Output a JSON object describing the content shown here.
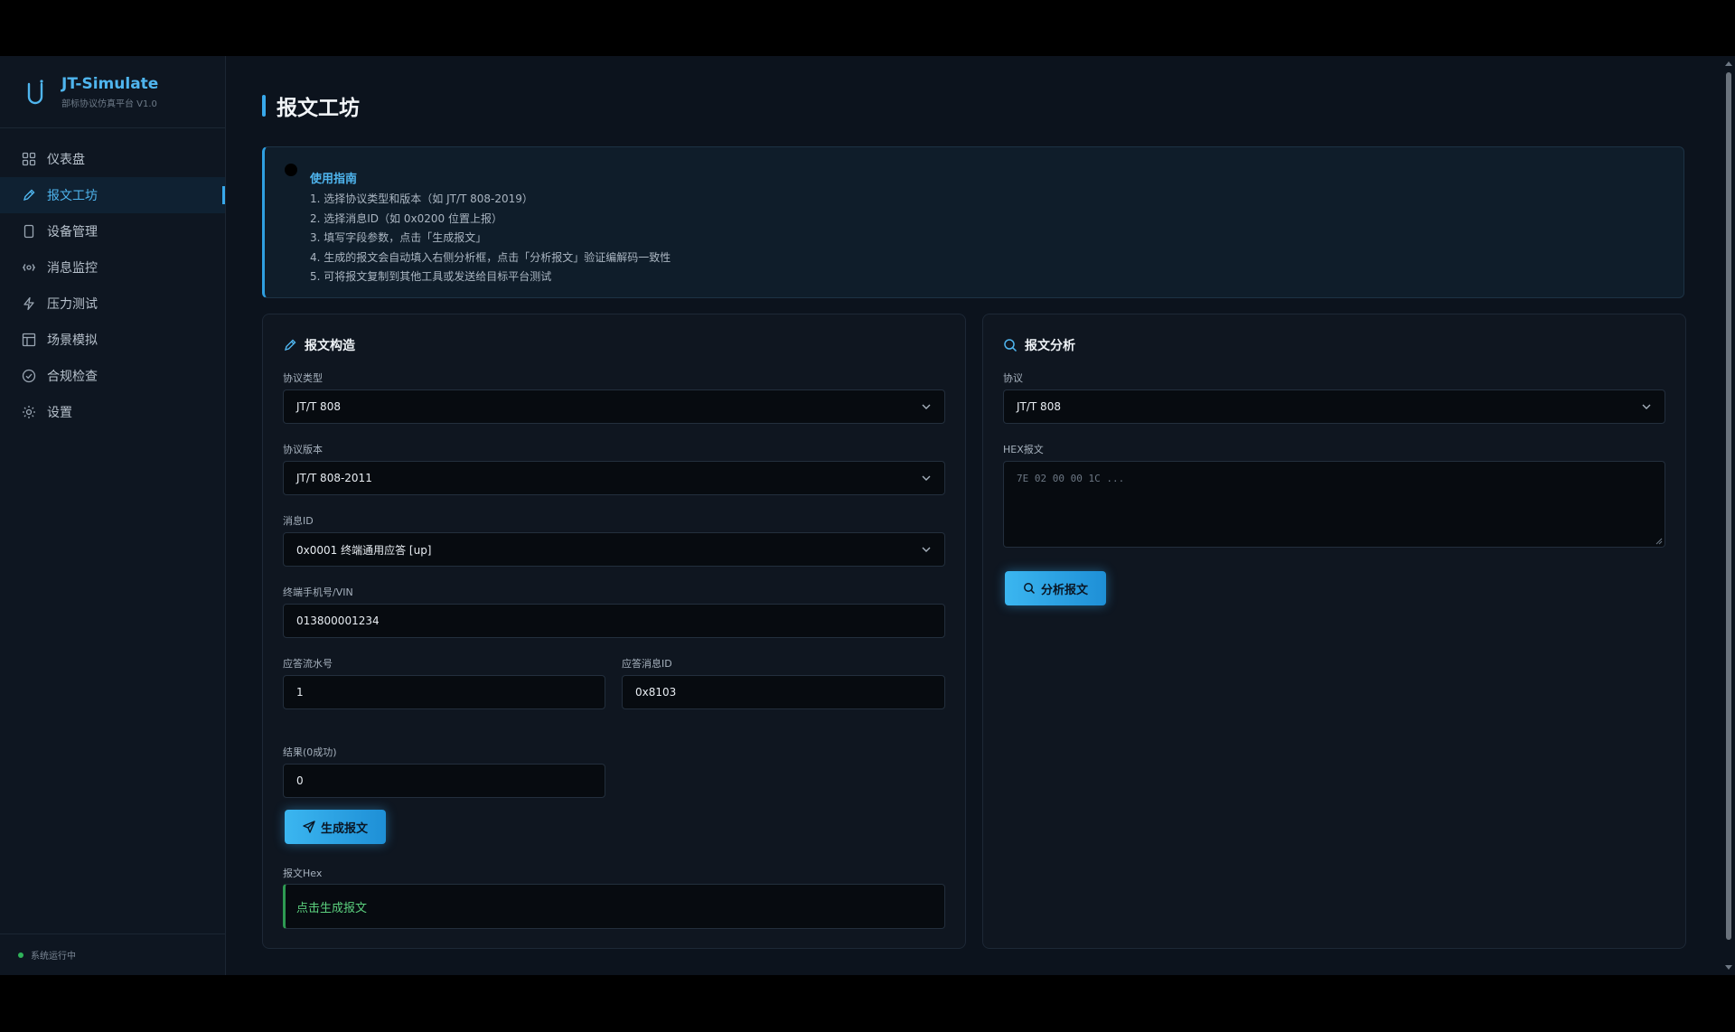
{
  "brand": {
    "title": "JT-Simulate",
    "subtitle": "部标协议仿真平台 V1.0"
  },
  "sidebar": {
    "items": [
      {
        "label": "仪表盘",
        "icon": "dashboard-icon"
      },
      {
        "label": "报文工坊",
        "icon": "pencil-icon",
        "active": true
      },
      {
        "label": "设备管理",
        "icon": "device-icon"
      },
      {
        "label": "消息监控",
        "icon": "monitor-icon"
      },
      {
        "label": "压力测试",
        "icon": "bolt-icon"
      },
      {
        "label": "场景模拟",
        "icon": "layout-icon"
      },
      {
        "label": "合规检查",
        "icon": "check-circle-icon"
      },
      {
        "label": "设置",
        "icon": "gear-icon"
      }
    ],
    "status": "系统运行中"
  },
  "page": {
    "title": "报文工坊"
  },
  "guide": {
    "title": "使用指南",
    "steps": [
      "1. 选择协议类型和版本（如 JT/T 808-2019）",
      "2. 选择消息ID（如 0x0200 位置上报）",
      "3. 填写字段参数，点击「生成报文」",
      "4. 生成的报文会自动填入右侧分析框，点击「分析报文」验证编解码一致性",
      "5. 可将报文复制到其他工具或发送给目标平台测试"
    ]
  },
  "builder": {
    "title": "报文构造",
    "protocol_type_label": "协议类型",
    "protocol_type_value": "JT/T 808",
    "protocol_version_label": "协议版本",
    "protocol_version_value": "JT/T 808-2011",
    "message_id_label": "消息ID",
    "message_id_value": "0x0001 终端通用应答 [up]",
    "terminal_label": "终端手机号/VIN",
    "terminal_value": "013800001234",
    "reply_serial_label": "应答流水号",
    "reply_serial_value": "1",
    "reply_msgid_label": "应答消息ID",
    "reply_msgid_value": "0x8103",
    "result_label": "结果(0成功)",
    "result_value": "0",
    "generate_button": "生成报文",
    "hex_label": "报文Hex",
    "hex_placeholder": "点击生成报文"
  },
  "analyzer": {
    "title": "报文分析",
    "protocol_label": "协议",
    "protocol_value": "JT/T 808",
    "hex_label": "HEX报文",
    "hex_placeholder": "7E 02 00 00 1C ...",
    "analyze_button": "分析报文"
  },
  "colors": {
    "accent": "#38a8ea",
    "background": "#0c131d",
    "success": "#2fb35a"
  }
}
